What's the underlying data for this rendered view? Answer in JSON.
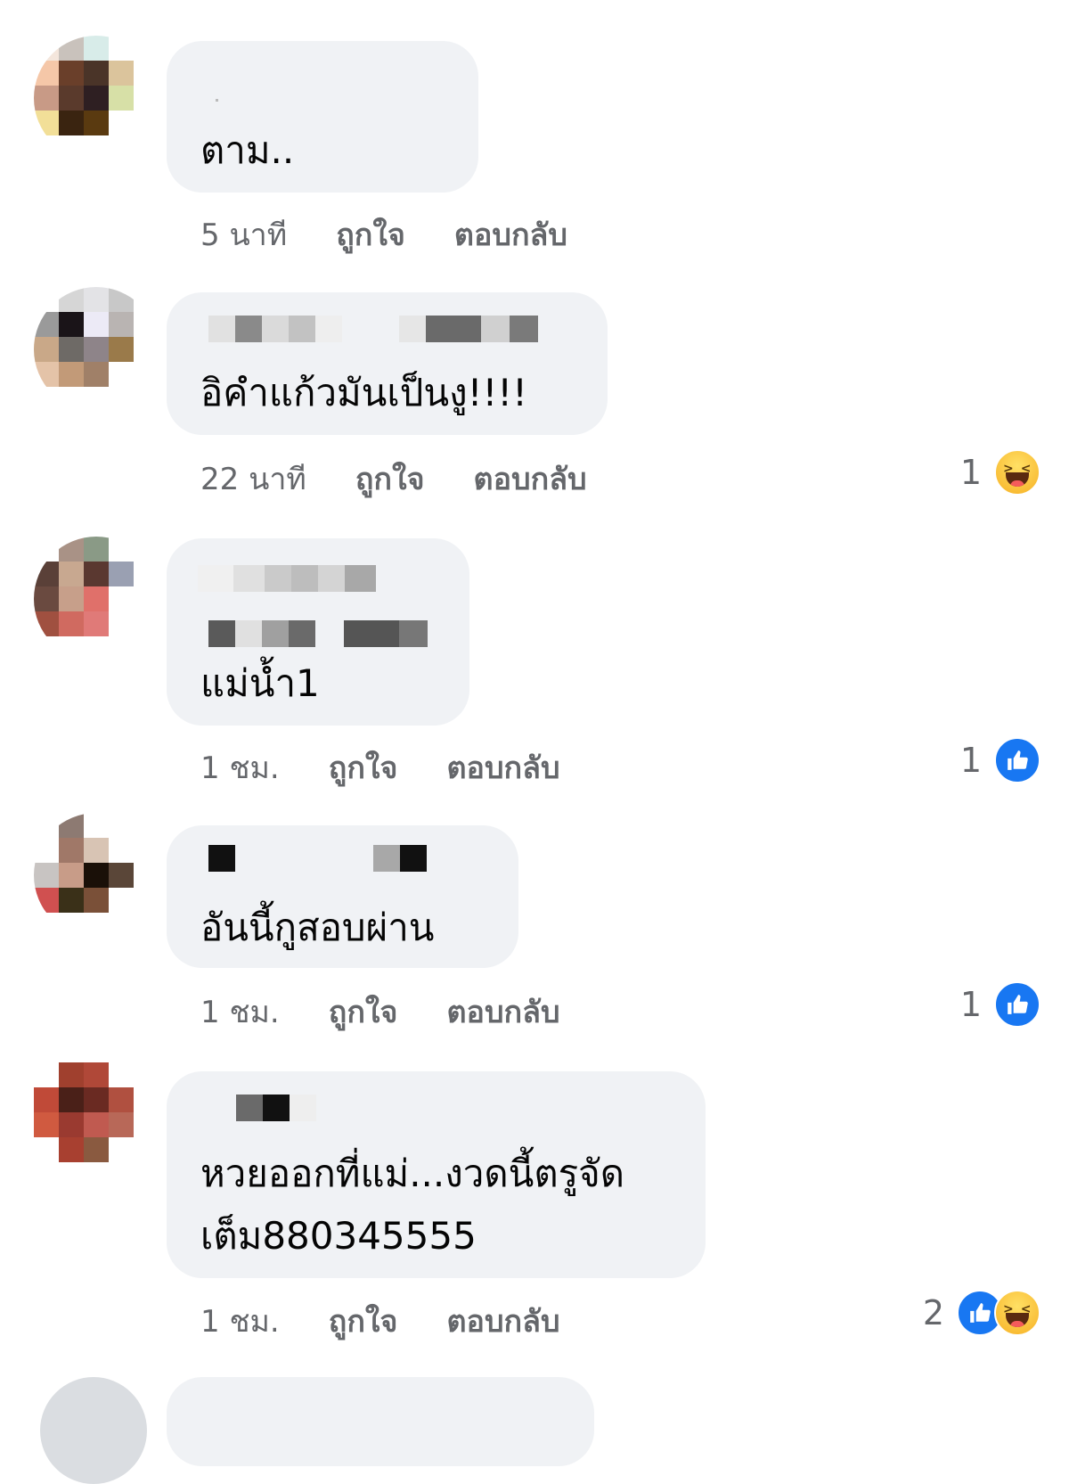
{
  "comments": [
    {
      "text_lines": [
        "ตาม.."
      ],
      "time": "5 นาที",
      "like_label": "ถูกใจ",
      "reply_label": "ตอบกลับ",
      "reaction_count": null,
      "reactions": []
    },
    {
      "text_lines": [
        "อิคำแก้วมันเป็นงู!!!!"
      ],
      "time": "22 นาที",
      "like_label": "ถูกใจ",
      "reply_label": "ตอบกลับ",
      "reaction_count": "1",
      "reactions": [
        "haha-icon"
      ]
    },
    {
      "text_lines": [
        "แม่น้ำ1"
      ],
      "time": "1 ชม.",
      "like_label": "ถูกใจ",
      "reply_label": "ตอบกลับ",
      "reaction_count": "1",
      "reactions": [
        "like-icon"
      ]
    },
    {
      "text_lines": [
        "อันนี้กูสอบผ่าน"
      ],
      "time": "1 ชม.",
      "like_label": "ถูกใจ",
      "reply_label": "ตอบกลับ",
      "reaction_count": "1",
      "reactions": [
        "like-icon"
      ]
    },
    {
      "text_lines": [
        "หวยออกที่แม่...งวดนี้ตรูจัด",
        "เต็ม880345555"
      ],
      "time": "1 ชม.",
      "like_label": "ถูกใจ",
      "reply_label": "ตอบกลับ",
      "reaction_count": "2",
      "reactions": [
        "like-icon",
        "haha-icon"
      ]
    }
  ],
  "colors": {
    "bubble": "#f0f2f5",
    "muted_text": "#65676b",
    "like_blue": "#1877f2",
    "haha_yellow": "#f7b125"
  }
}
